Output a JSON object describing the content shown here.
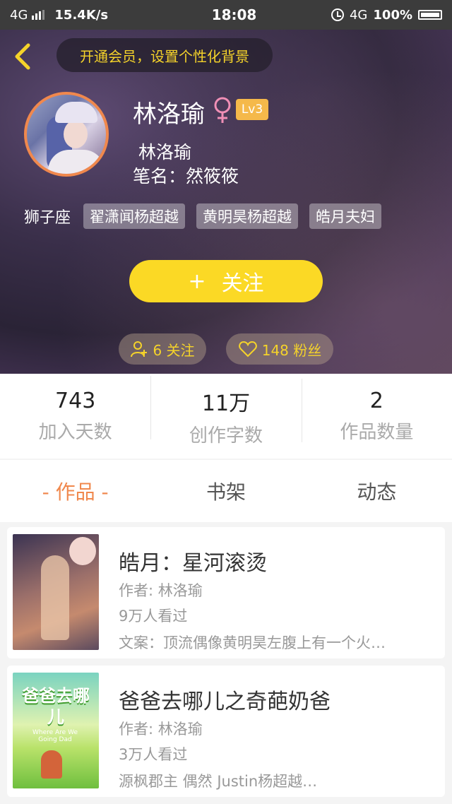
{
  "status_bar": {
    "network": "4G",
    "speed": "15.4K/s",
    "time": "18:08",
    "network_right": "4G",
    "battery": "100%"
  },
  "header": {
    "vip_prompt": "开通会员，设置个性化背景",
    "user_name": "林洛瑜",
    "level": "Lv3",
    "nickname": "林洛瑜",
    "pen_name": "笔名：然筱筱",
    "zodiac": "狮子座",
    "tags": [
      "翟潇闻杨超越",
      "黄明昊杨超越",
      "皓月夫妇"
    ],
    "follow_button": "关注",
    "follow_plus": "+",
    "follows_label": "6 关注",
    "fans_label": "148 粉丝"
  },
  "stats": [
    {
      "value": "743",
      "label": "加入天数"
    },
    {
      "value": "11万",
      "label": "创作字数"
    },
    {
      "value": "2",
      "label": "作品数量"
    }
  ],
  "tabs": [
    "- 作品 -",
    "书架",
    "动态"
  ],
  "works": [
    {
      "title": "皓月：星河滚烫",
      "author": "作者: 林洛瑜",
      "views": "9万人看过",
      "summary": "文案：顶流偶像黄明昊左腹上有一个火…"
    },
    {
      "title": "爸爸去哪儿之奇葩奶爸",
      "author": "作者: 林洛瑜",
      "views": "3万人看过",
      "summary": "源枫郡主   偶然  Justin杨超越…",
      "cover_text": "爸爸去哪儿",
      "cover_small": "Where Are We Going Dad"
    }
  ],
  "colors": {
    "accent_orange": "#f0884d",
    "follow_yellow": "#fbd925",
    "vip_yellow": "#f5d32a",
    "level_badge": "#f5b94a"
  }
}
